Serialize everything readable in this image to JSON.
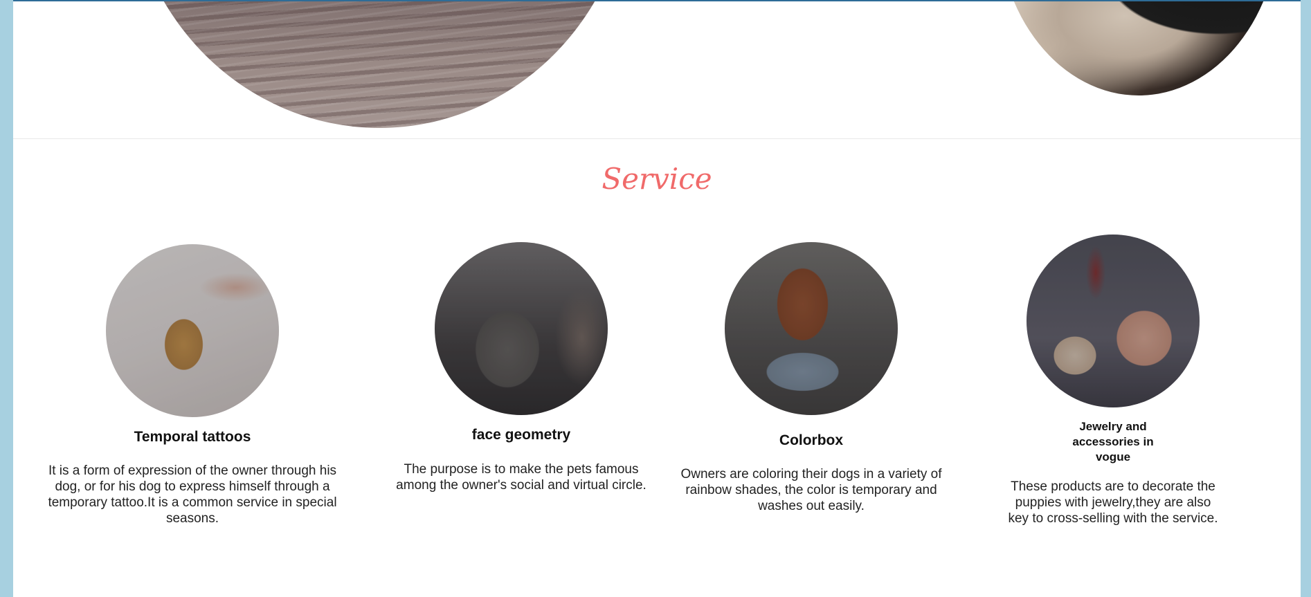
{
  "section": {
    "title": "Service"
  },
  "services": [
    {
      "title": "Temporal tattoos",
      "description": "It is a form of expression of the owner through his dog, or for his dog to express himself through a temporary tattoo.It is a common service in special seasons."
    },
    {
      "title": "face geometry",
      "description": "The purpose is to make the pets famous among the owner's social and virtual circle."
    },
    {
      "title": "Colorbox",
      "description": "Owners are coloring their dogs in a variety of rainbow shades, the color is temporary and washes out easily."
    },
    {
      "title": "Jewelry and accessories in vogue",
      "description": "These products are to decorate the puppies with jewelry,they are also key to cross-selling with the service."
    }
  ],
  "colors": {
    "accent": "#f06a6a",
    "page_frame": "#a7d0e0",
    "top_border": "#2e6c97"
  }
}
